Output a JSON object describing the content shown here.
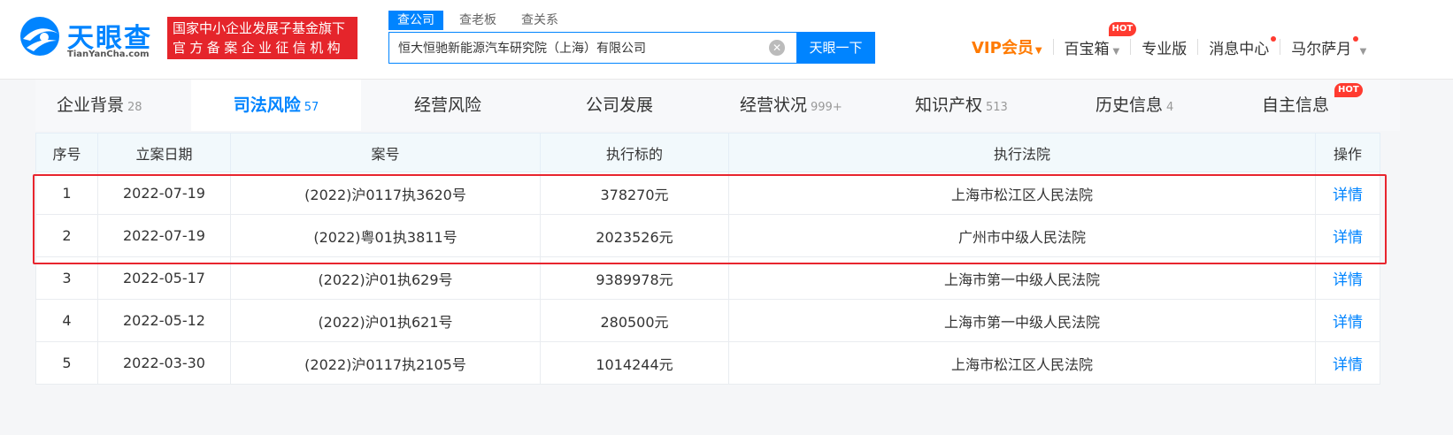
{
  "logo": {
    "name_cn": "天眼查",
    "name_en": "TianYanCha.com"
  },
  "banner": {
    "line1": "国家中小企业发展子基金旗下",
    "line2": "官方备案企业征信机构"
  },
  "search": {
    "tabs": [
      "查公司",
      "查老板",
      "查关系"
    ],
    "value": "恒大恒驰新能源汽车研究院（上海）有限公司",
    "button_label": "天眼一下"
  },
  "nav": {
    "vip_label": "VIP会员",
    "toolbox_label": "百宝箱",
    "hot_label": "HOT",
    "pro_label": "专业版",
    "messages_label": "消息中心",
    "user_label": "马尔萨月"
  },
  "module_tabs": [
    {
      "label": "企业背景",
      "count": "28"
    },
    {
      "label": "司法风险",
      "count": "57"
    },
    {
      "label": "经营风险",
      "count": ""
    },
    {
      "label": "公司发展",
      "count": ""
    },
    {
      "label": "经营状况",
      "count": "999+"
    },
    {
      "label": "知识产权",
      "count": "513"
    },
    {
      "label": "历史信息",
      "count": "4"
    },
    {
      "label": "自主信息",
      "count": "",
      "badge": "HOT"
    }
  ],
  "table": {
    "headers": [
      "序号",
      "立案日期",
      "案号",
      "执行标的",
      "执行法院",
      "操作"
    ],
    "rows": [
      {
        "no": "1",
        "date": "2022-07-19",
        "case": "(2022)沪0117执3620号",
        "amount": "378270元",
        "court": "上海市松江区人民法院",
        "action": "详情"
      },
      {
        "no": "2",
        "date": "2022-07-19",
        "case": "(2022)粤01执3811号",
        "amount": "2023526元",
        "court": "广州市中级人民法院",
        "action": "详情"
      },
      {
        "no": "3",
        "date": "2022-05-17",
        "case": "(2022)沪01执629号",
        "amount": "9389978元",
        "court": "上海市第一中级人民法院",
        "action": "详情"
      },
      {
        "no": "4",
        "date": "2022-05-12",
        "case": "(2022)沪01执621号",
        "amount": "280500元",
        "court": "上海市第一中级人民法院",
        "action": "详情"
      },
      {
        "no": "5",
        "date": "2022-03-30",
        "case": "(2022)沪0117执2105号",
        "amount": "1014244元",
        "court": "上海市松江区人民法院",
        "action": "详情"
      }
    ]
  },
  "colors": {
    "brand_blue": "#0084ff",
    "vip_orange": "#ff7a00",
    "highlight_red": "#e8252e"
  }
}
